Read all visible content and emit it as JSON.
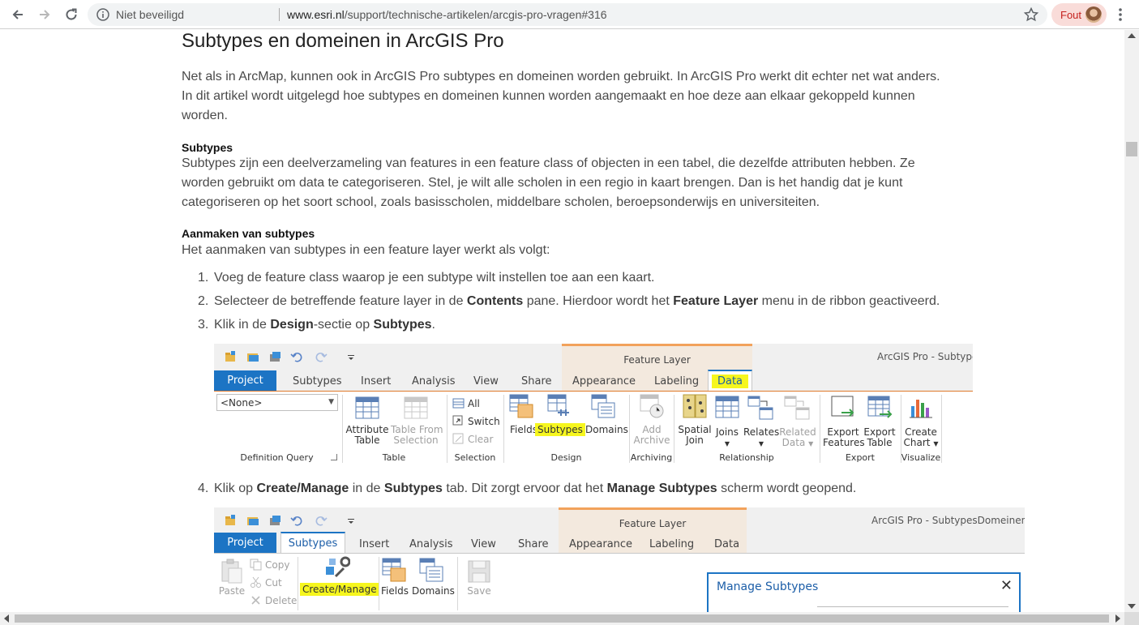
{
  "browser": {
    "security_label": "Niet beveiligd",
    "url_host": "www.esri.nl",
    "url_path": "/support/technische-artikelen/arcgis-pro-vragen#316",
    "profile_label": "Fout"
  },
  "article": {
    "title": "Subtypes en domeinen in ArcGIS Pro",
    "intro": "Net als in ArcMap, kunnen ook in ArcGIS Pro subtypes en domeinen worden gebruikt. In ArcGIS Pro werkt dit echter net wat anders. In dit artikel wordt uitgelegd hoe subtypes en domeinen kunnen worden aangemaakt en hoe deze aan elkaar gekoppeld kunnen worden.",
    "subtypes_heading": "Subtypes",
    "subtypes_text": "Subtypes zijn een deelverzameling van features in een feature class of objecten in een tabel, die dezelfde attributen hebben. Ze worden gebruikt om data te categoriseren. Stel, je wilt alle scholen in een regio in kaart brengen. Dan is het handig dat je kunt categoriseren op het soort school, zoals basisscholen, middelbare scholen, beroepsonderwijs en universiteiten.",
    "create_heading": "Aanmaken van subtypes",
    "create_text": "Het aanmaken van subtypes in een feature layer werkt als volgt:",
    "steps": [
      {
        "num": "1.",
        "t1": "Voeg de feature class waarop je een subtype wilt instellen toe aan een kaart."
      },
      {
        "num": "2.",
        "t1": "Selecteer de betreffende feature layer in de ",
        "b1": "Contents",
        "t2": " pane. Hierdoor wordt het ",
        "b2": "Feature Layer",
        "t3": " menu in de ribbon geactiveerd."
      },
      {
        "num": "3.",
        "t1": "Klik in de ",
        "b1": "Design",
        "t2": "-sectie op ",
        "b2": "Subtypes",
        "t3": "."
      },
      {
        "num": "4.",
        "t1": "Klik op ",
        "b1": "Create/Manage",
        "t2": " in de ",
        "b2": "Subtypes",
        "t3": " tab. Dit zorgt ervoor dat het ",
        "b3": "Manage Subtypes",
        "t4": " scherm wordt geopend."
      }
    ]
  },
  "ribbon1": {
    "context": "Feature Layer",
    "app_title": "ArcGIS Pro - SubtypesD",
    "tabs": {
      "project": "Project",
      "subtypes": "Subtypes",
      "insert": "Insert",
      "analysis": "Analysis",
      "view": "View",
      "share": "Share",
      "appearance": "Appearance",
      "labeling": "Labeling",
      "data": "Data"
    },
    "combo_value": "<None>",
    "groups": {
      "def_query": "Definition Query",
      "table": "Table",
      "selection": "Selection",
      "design": "Design",
      "archiving": "Archiving",
      "relationship": "Relationship",
      "export": "Export",
      "visualize": "Visualize"
    },
    "buttons": {
      "attr_table_1": "Attribute",
      "attr_table_2": "Table",
      "table_sel_1": "Table From",
      "table_sel_2": "Selection",
      "sel_all": "All",
      "sel_switch": "Switch",
      "sel_clear": "Clear",
      "fields": "Fields",
      "subtypes": "Subtypes",
      "domains": "Domains",
      "add_archive_1": "Add",
      "add_archive_2": "Archive",
      "spatial_join_1": "Spatial",
      "spatial_join_2": "Join",
      "joins": "Joins",
      "relates": "Relates",
      "related_data_1": "Related",
      "related_data_2": "Data",
      "export_features_1": "Export",
      "export_features_2": "Features",
      "export_table_1": "Export",
      "export_table_2": "Table",
      "create_chart_1": "Create",
      "create_chart_2": "Chart"
    }
  },
  "ribbon2": {
    "context": "Feature Layer",
    "app_title": "ArcGIS Pro - SubtypesDomeinen - Su",
    "tabs": {
      "project": "Project",
      "subtypes": "Subtypes",
      "insert": "Insert",
      "analysis": "Analysis",
      "view": "View",
      "share": "Share",
      "appearance": "Appearance",
      "labeling": "Labeling",
      "data": "Data"
    },
    "buttons": {
      "paste": "Paste",
      "copy": "Copy",
      "cut": "Cut",
      "delete": "Delete",
      "create_manage": "Create/Manage",
      "fields": "Fields",
      "domains": "Domains",
      "save": "Save"
    },
    "dialog_title": "Manage Subtypes"
  },
  "colors": {
    "accent": "#1c74c4",
    "context_band": "#f3e9de",
    "context_border": "#f2a25b",
    "highlight": "#f6f61e"
  }
}
